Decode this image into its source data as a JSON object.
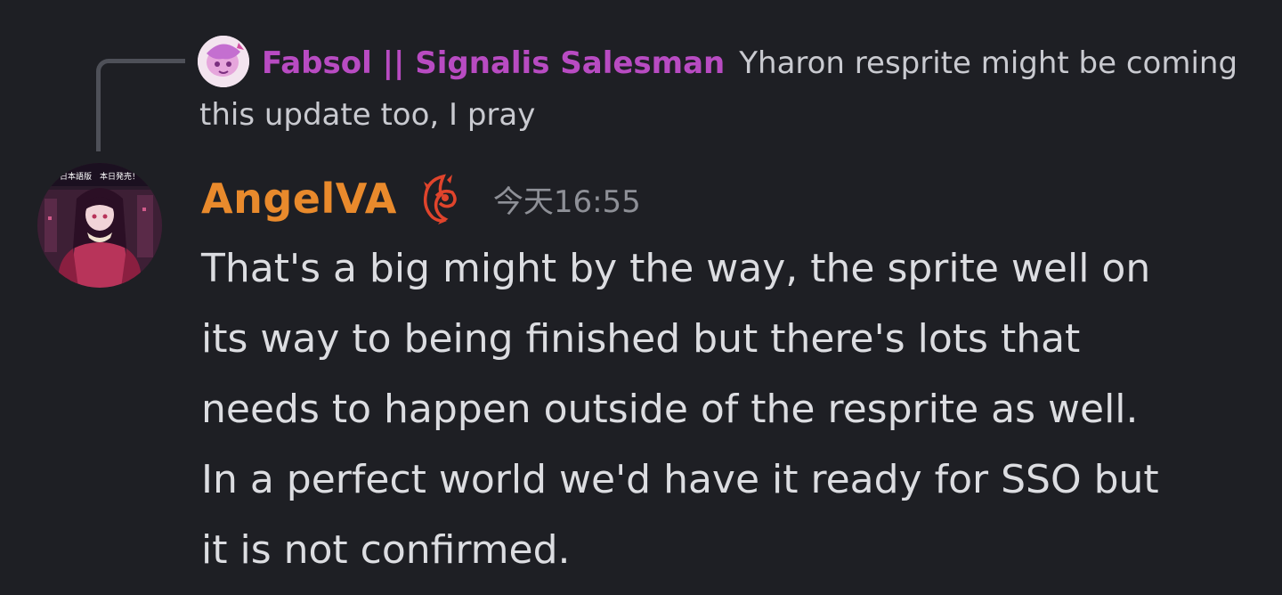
{
  "reply": {
    "author": "Fabsol || Signalis Salesman",
    "text_line1": "Yharon resprite might be coming",
    "text_line2": "this update too, I pray"
  },
  "message": {
    "author": "AngelVA",
    "timestamp": "今天16:55",
    "avatar_text": "日本語版　本日発売！",
    "lines": [
      "That's a big might by the way, the sprite well on",
      "its way to being finished but there's lots that",
      "needs to happen outside of the resprite as well.",
      "In a perfect world we'd have it ready for SSO but",
      "it is not confirmed."
    ]
  },
  "colors": {
    "background": "#1e1f24",
    "reply_author": "#b84bc2",
    "author": "#e98a2c",
    "text": "#dcdde1",
    "timestamp": "#8e9097",
    "spine": "#4e5058"
  },
  "icons": {
    "reply_avatar": "pink-character-avatar",
    "main_avatar": "anime-girl-avatar",
    "role_icon": "red-dragon-role-icon"
  }
}
